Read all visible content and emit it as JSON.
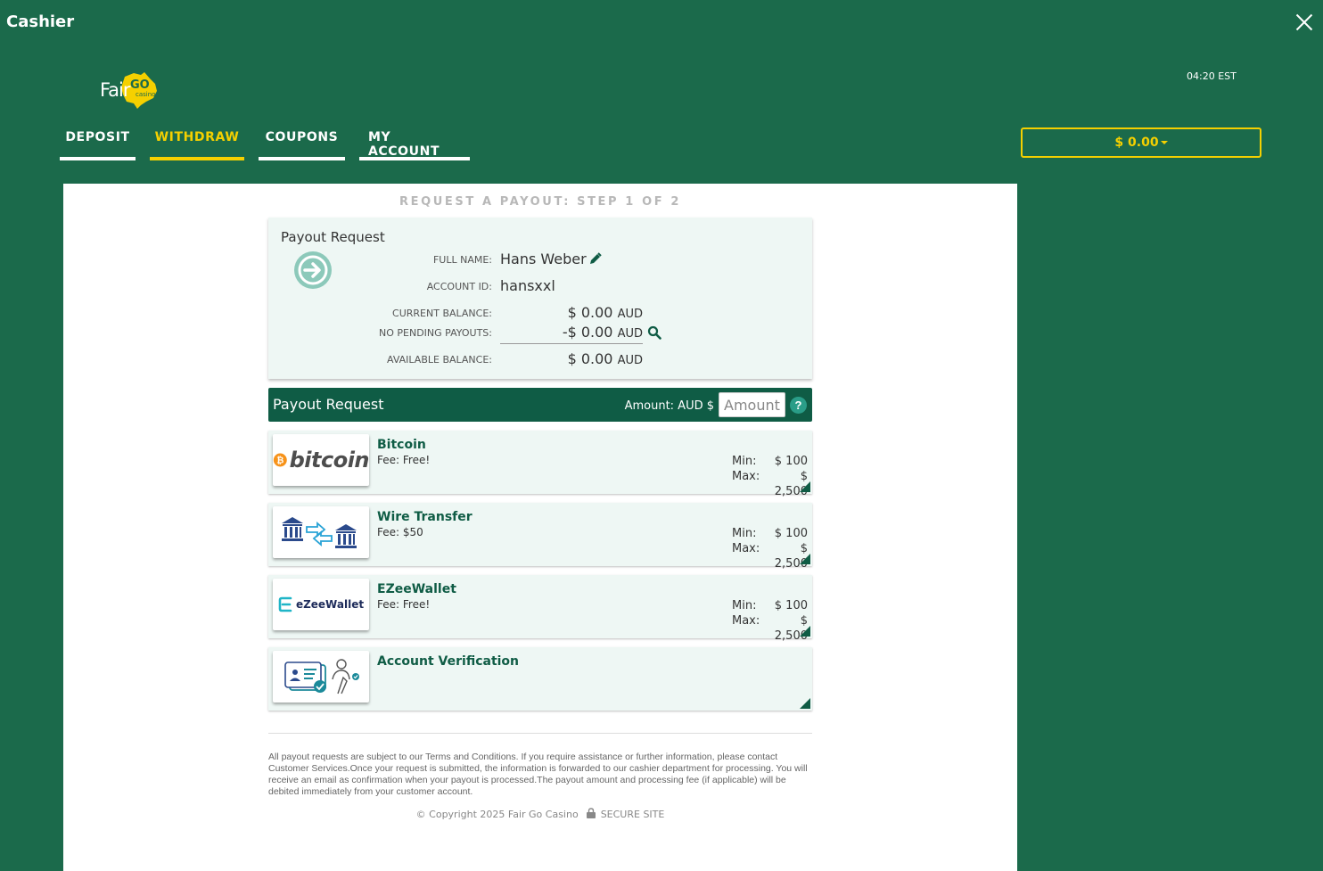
{
  "header": {
    "title": "Cashier",
    "time": "04:20 EST"
  },
  "logo": {
    "text": "Fair",
    "badge": "GO",
    "sub": "casino"
  },
  "nav": {
    "tabs": [
      {
        "label": "DEPOSIT"
      },
      {
        "label": "WITHDRAW",
        "active": true
      },
      {
        "label": "COUPONS"
      },
      {
        "label": "MY ACCOUNT"
      }
    ]
  },
  "balance_button": {
    "label": "$ 0.00"
  },
  "step_title": "REQUEST A PAYOUT: STEP 1 OF 2",
  "summary": {
    "title": "Payout Request",
    "full_name_label": "FULL NAME:",
    "full_name": "Hans Weber",
    "account_id_label": "ACCOUNT ID:",
    "account_id": "hansxxl",
    "current_balance_label": "CURRENT BALANCE:",
    "current_balance": "$ 0.00",
    "pending_label": "NO PENDING PAYOUTS:",
    "pending": "-$ 0.00",
    "available_label": "AVAILABLE BALANCE:",
    "available": "$ 0.00",
    "currency": "AUD"
  },
  "request_bar": {
    "title": "Payout Request",
    "amount_label": "Amount:  AUD $",
    "amount_placeholder": "Amount",
    "help": "?"
  },
  "methods": [
    {
      "name": "Bitcoin",
      "fee": "Fee: Free!",
      "min_label": "Min:",
      "min": "$ 100",
      "max_label": "Max:",
      "max": "$ 2,500",
      "logo_text": "bitcoin"
    },
    {
      "name": "Wire Transfer",
      "fee": "Fee: $50",
      "min_label": "Min:",
      "min": "$ 100",
      "max_label": "Max:",
      "max": "$ 2,500"
    },
    {
      "name": "EZeeWallet",
      "fee": "Fee: Free!",
      "min_label": "Min:",
      "min": "$ 100",
      "max_label": "Max:",
      "max": "$ 2,500",
      "logo_text": "eZeeWallet"
    },
    {
      "name": "Account Verification"
    }
  ],
  "footer": {
    "disclaimer": "All payout requests are subject to our Terms and Conditions. If you require assistance or further information, please contact Customer Services.Once your request is submitted, the information is forwarded to our cashier department for processing. You will receive an email as confirmation when your payout is processed.The payout amount and processing fee (if applicable) will be debited immediately from your customer account.",
    "copyright": "© Copyright 2025 Fair Go Casino",
    "secure": "SECURE SITE"
  },
  "colors": {
    "background": "#1b6a4b",
    "accent": "#f5d000",
    "dark_green": "#0f5c45",
    "panel_tint": "#eef7f4"
  }
}
